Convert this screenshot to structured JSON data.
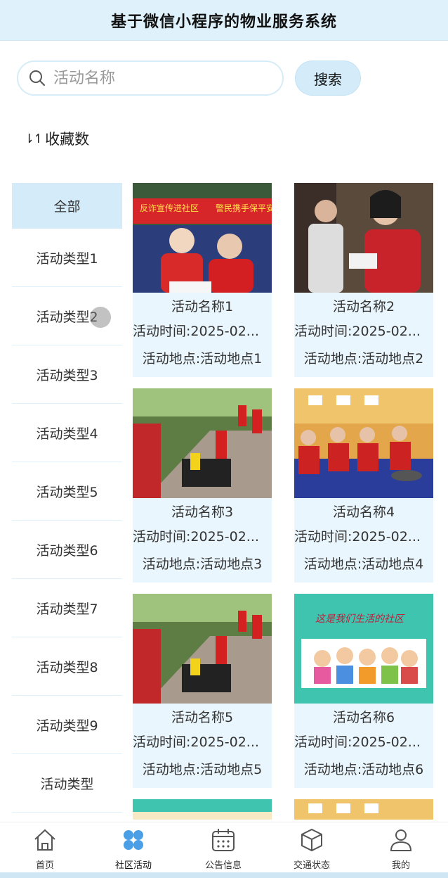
{
  "header": {
    "title": "基于微信小程序的物业服务系统"
  },
  "search": {
    "placeholder": "活动名称",
    "button": "搜索",
    "icon": "search-icon"
  },
  "sort": {
    "icon": "sort-icon",
    "label": "收藏数"
  },
  "sidebar": {
    "items": [
      {
        "label": "全部",
        "active": true
      },
      {
        "label": "活动类型1"
      },
      {
        "label": "活动类型2"
      },
      {
        "label": "活动类型3"
      },
      {
        "label": "活动类型4"
      },
      {
        "label": "活动类型5"
      },
      {
        "label": "活动类型6"
      },
      {
        "label": "活动类型7"
      },
      {
        "label": "活动类型8"
      },
      {
        "label": "活动类型9"
      },
      {
        "label": "活动类型"
      }
    ]
  },
  "activities": [
    {
      "name": "活动名称1",
      "time": "活动时间:2025-02...",
      "place": "活动地点:活动地点1",
      "banner_left": "反诈宣传进社区",
      "banner_right": "警民携手保平安"
    },
    {
      "name": "活动名称2",
      "time": "活动时间:2025-02...",
      "place": "活动地点:活动地点2"
    },
    {
      "name": "活动名称3",
      "time": "活动时间:2025-02...",
      "place": "活动地点:活动地点3"
    },
    {
      "name": "活动名称4",
      "time": "活动时间:2025-02...",
      "place": "活动地点:活动地点4"
    },
    {
      "name": "活动名称5",
      "time": "活动时间:2025-02...",
      "place": "活动地点:活动地点5"
    },
    {
      "name": "活动名称6",
      "time": "活动时间:2025-02...",
      "place": "活动地点:活动地点6",
      "poster_text": "这是我们生活的社区"
    }
  ],
  "tabbar": {
    "tabs": [
      {
        "label": "首页",
        "icon": "home-icon"
      },
      {
        "label": "社区活动",
        "icon": "community-icon",
        "active": true
      },
      {
        "label": "公告信息",
        "icon": "calendar-icon"
      },
      {
        "label": "交通状态",
        "icon": "box-icon"
      },
      {
        "label": "我的",
        "icon": "user-icon"
      }
    ]
  },
  "colors": {
    "accent": "#d4ecfa",
    "header_bg": "#dff1fb",
    "active_icon": "#4a9fe6"
  }
}
